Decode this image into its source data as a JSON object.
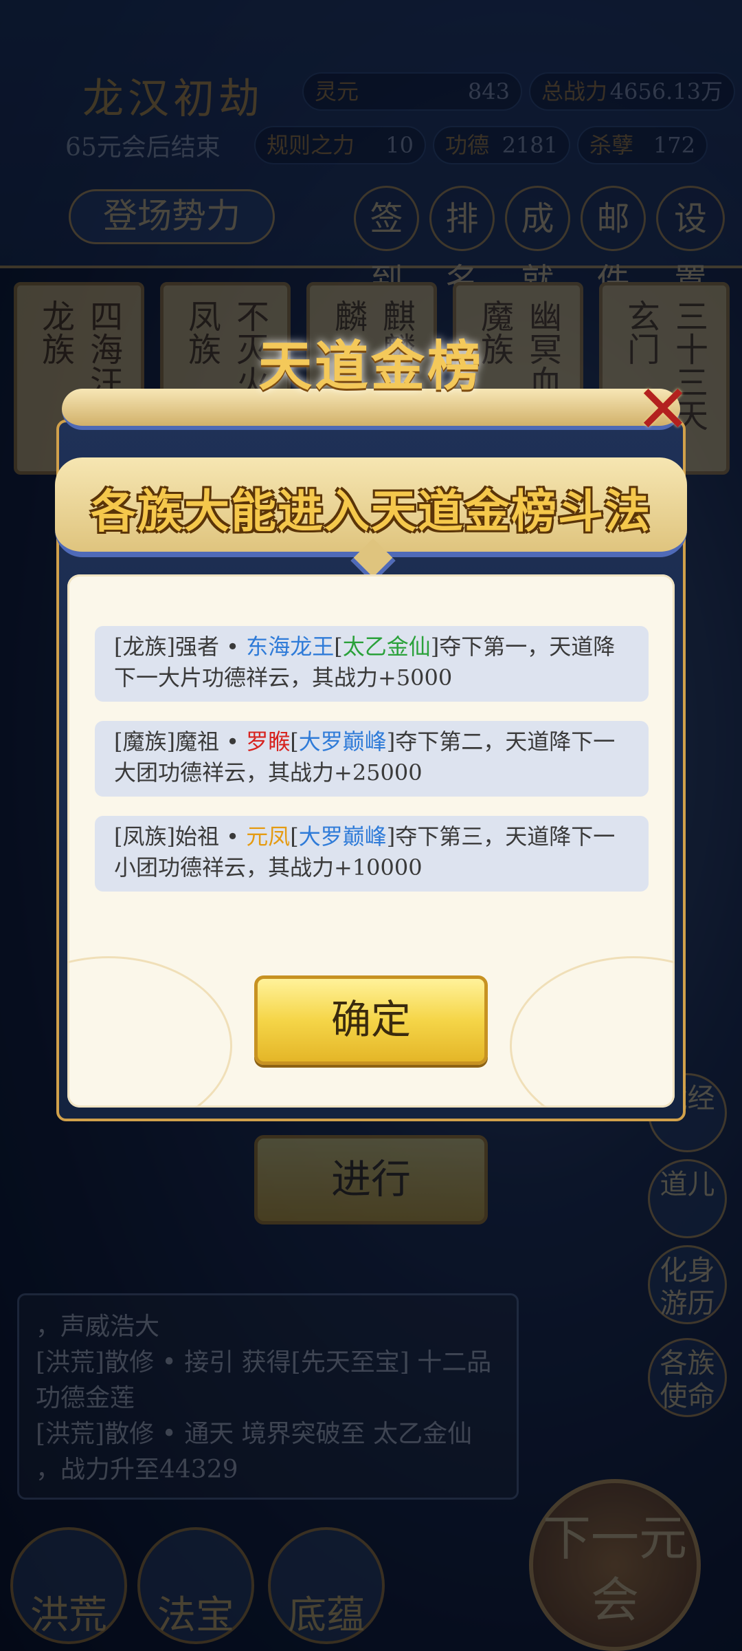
{
  "background": {
    "game_title": "龙汉初劫",
    "countdown": "65元会后结束",
    "resources": [
      {
        "label": "灵元",
        "value": "843"
      },
      {
        "label": "总战力",
        "value": "4656.13万"
      },
      {
        "label": "规则之力",
        "value": "10"
      },
      {
        "label": "功德",
        "value": "2181"
      },
      {
        "label": "杀孽",
        "value": "172"
      }
    ],
    "factions_button": "登场势力",
    "top_icons": [
      "签到",
      "排名",
      "成就",
      "邮件",
      "设置"
    ],
    "faction_cards": [
      {
        "region": "四海汪洋",
        "name": "龙族"
      },
      {
        "region": "不灭火山",
        "name": "凤族"
      },
      {
        "region": "麒麟崖",
        "name": "麒麟"
      },
      {
        "region": "幽冥血海",
        "name": "魔族"
      },
      {
        "region": "三十三天",
        "name": "玄门"
      }
    ],
    "under_button": "进行",
    "log_lines": [
      "，声威浩大",
      "[洪荒]散修 • 接引 获得[先天至宝]        十二品功德金莲",
      "[洪荒]散修 • 通天 境界突破至 太乙金仙",
      "，战力升至44329"
    ],
    "side_buttons": [
      "藏经",
      "道儿",
      "化身游历",
      "各族使命"
    ],
    "bottom_buttons": [
      "洪荒",
      "法宝",
      "底蕴"
    ],
    "next_button": "下一元会"
  },
  "modal": {
    "title": "天道金榜",
    "close_icon": "close-x-icon",
    "headline": "各族大能进入天道金榜斗法",
    "entries": [
      {
        "faction": "[龙族]",
        "role": "强者 • ",
        "person": "东海龙王",
        "rank_open": "[",
        "rank": "太乙金仙",
        "rank_close": "]",
        "rest": "夺下第一，天道降下一大片功德祥云，其战力+5000",
        "person_color": "#2f7bd8",
        "rank_color": "#2aa13a"
      },
      {
        "faction": "[魔族]",
        "role": "魔祖 • ",
        "person": "罗睺",
        "rank_open": "[",
        "rank": "大罗巅峰",
        "rank_close": "]",
        "rest": "夺下第二，天道降下一大团功德祥云，其战力+25000",
        "person_color": "#d7231f",
        "rank_color": "#2f7bd8"
      },
      {
        "faction": "[凤族]",
        "role": "始祖 • ",
        "person": "元凤",
        "rank_open": "[",
        "rank": "大罗巅峰",
        "rank_close": "]",
        "rest": "夺下第三，天道降下一小团功德祥云，其战力+10000",
        "person_color": "#e59b12",
        "rank_color": "#2f7bd8"
      }
    ],
    "confirm_button": "确定"
  }
}
